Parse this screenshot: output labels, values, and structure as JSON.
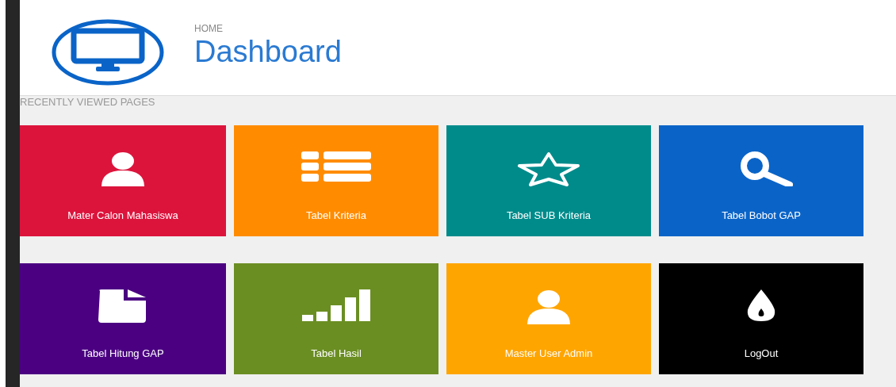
{
  "header": {
    "breadcrumb": "HOME",
    "title": "Dashboard"
  },
  "section_label": "RECENTLY VIEWED PAGES",
  "tiles": [
    {
      "label": "Mater Calon Mahasiswa",
      "color": "#dc143c"
    },
    {
      "label": "Tabel Kriteria",
      "color": "#ff8c00"
    },
    {
      "label": "Tabel SUB Kriteria",
      "color": "#008b8b"
    },
    {
      "label": "Tabel Bobot GAP",
      "color": "#0a64c8"
    },
    {
      "label": "Tabel Hitung GAP",
      "color": "#4b0082"
    },
    {
      "label": "Tabel Hasil",
      "color": "#6b8e23"
    },
    {
      "label": "Master User Admin",
      "color": "#ffa500"
    },
    {
      "label": "LogOut",
      "color": "#000000"
    }
  ]
}
